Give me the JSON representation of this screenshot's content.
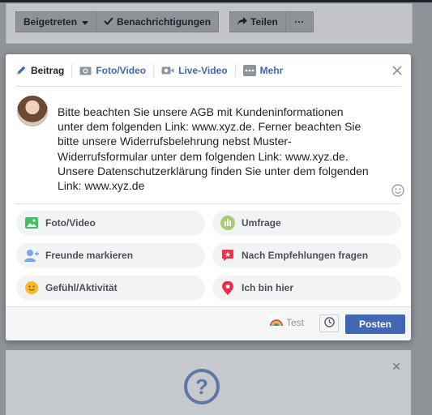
{
  "toolbar": {
    "joined_label": "Beigetreten",
    "notifications_label": "Benachrichtigungen",
    "share_label": "Teilen",
    "more_label": "···"
  },
  "composer": {
    "tabs": [
      {
        "label": "Beitrag"
      },
      {
        "label": "Foto/Video"
      },
      {
        "label": "Live-Video"
      },
      {
        "label": "Mehr"
      }
    ],
    "post_text": "Bitte beachten Sie unsere AGB mit Kundeninformationen\nunter dem folgenden Link: www.xyz.de. Ferner beachten Sie\nbitte unsere Widerrufsbelehrung nebst Muster-\nWiderrufsformular unter dem folgenden Link: www.xyz.de.\nUnsere Datenschutzerklärung finden Sie unter dem folgenden\nLink: www.xyz.de",
    "actions": [
      {
        "label": "Foto/Video",
        "icon": "photo-icon"
      },
      {
        "label": "Umfrage",
        "icon": "poll-icon"
      },
      {
        "label": "Freunde markieren",
        "icon": "tag-friends-icon"
      },
      {
        "label": "Nach Empfehlungen fragen",
        "icon": "recommendations-icon"
      },
      {
        "label": "Gefühl/Aktivität",
        "icon": "feeling-icon"
      },
      {
        "label": "Ich bin hier",
        "icon": "location-pin-icon"
      }
    ],
    "audience_label": "Test",
    "post_button": "Posten"
  },
  "colors": {
    "brand_blue": "#4267b2",
    "background_overlay": "#8f9297"
  }
}
